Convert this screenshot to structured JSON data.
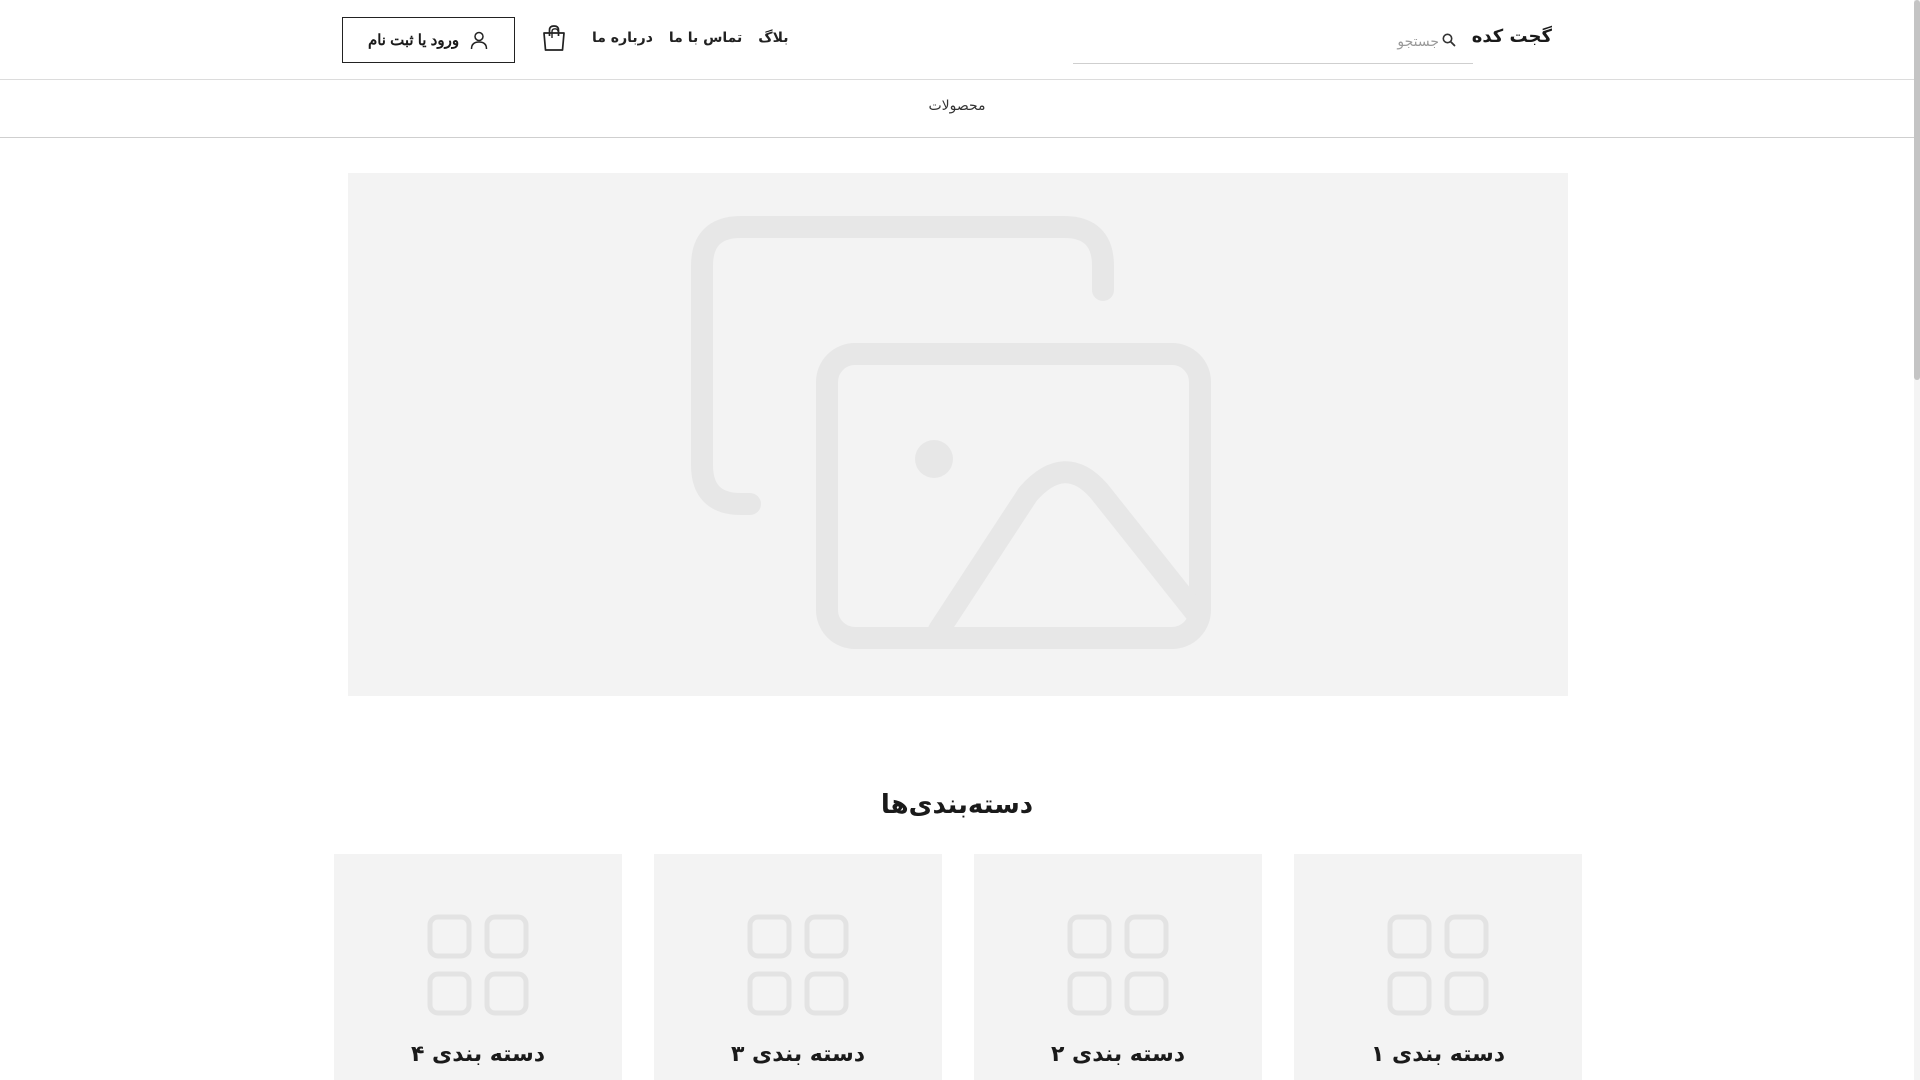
{
  "header": {
    "logo": "گجت کده",
    "search": {
      "placeholder": "جستجو",
      "icon": "search-icon"
    },
    "nav": [
      {
        "label": "درباره ما"
      },
      {
        "label": "تماس با ما"
      },
      {
        "label": "بلاگ"
      }
    ],
    "cart": {
      "icon": "shopping-bag-icon"
    },
    "login": {
      "label": "ورود یا ثبت نام",
      "icon": "user-icon"
    }
  },
  "subnav": {
    "products_label": "محصولات"
  },
  "hero": {
    "icon": "image-placeholder-icon"
  },
  "categories": {
    "title": "دسته‌بندی‌ها",
    "items": [
      {
        "label": "دسته بندی ۱",
        "icon": "grid-icon"
      },
      {
        "label": "دسته بندی ۲",
        "icon": "grid-icon"
      },
      {
        "label": "دسته بندی ۳",
        "icon": "grid-icon"
      },
      {
        "label": "دسته بندی ۴",
        "icon": "grid-icon"
      }
    ]
  },
  "colors": {
    "placeholder_bg": "#f3f3f3",
    "placeholder_icon": "#e6e6e6",
    "text": "#1a1a1a",
    "border": "#222222"
  }
}
